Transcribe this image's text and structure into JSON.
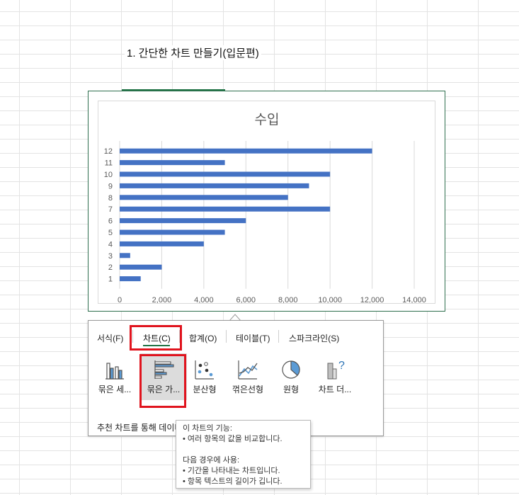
{
  "sheet": {
    "title": "1. 간단한 차트 만들기(입문편)"
  },
  "chart_data": {
    "type": "bar",
    "title": "수입",
    "categories": [
      "1",
      "2",
      "3",
      "4",
      "5",
      "6",
      "7",
      "8",
      "9",
      "10",
      "11",
      "12"
    ],
    "values": [
      1000,
      2000,
      500,
      4000,
      5000,
      6000,
      10000,
      8000,
      9000,
      10000,
      5000,
      12000
    ],
    "xlim": [
      0,
      14000
    ],
    "xticks": [
      "0",
      "2,000",
      "4,000",
      "6,000",
      "8,000",
      "10,000",
      "12,000",
      "14,000"
    ],
    "bar_color": "#4472c4",
    "grid": true
  },
  "quick_analysis": {
    "tabs": [
      {
        "label": "서식(F)",
        "active": false
      },
      {
        "label": "차트(C)",
        "active": true
      },
      {
        "label": "합계(O)",
        "active": false
      },
      {
        "label": "테이블(T)",
        "active": false
      },
      {
        "label": "스파크라인(S)",
        "active": false
      }
    ],
    "items": [
      {
        "label": "묶은 세...",
        "icon": "clustered-column-icon",
        "selected": false
      },
      {
        "label": "묶은 가...",
        "icon": "clustered-bar-icon",
        "selected": true
      },
      {
        "label": "분산형",
        "icon": "scatter-icon",
        "selected": false
      },
      {
        "label": "꺾은선형",
        "icon": "line-chart-icon",
        "selected": false
      },
      {
        "label": "원형",
        "icon": "pie-chart-icon",
        "selected": false
      },
      {
        "label": "차트 더...",
        "icon": "more-charts-icon",
        "selected": false
      }
    ],
    "hint": "추천 차트를 통해 데이터"
  },
  "tooltip": {
    "title": "이 차트의 기능:",
    "line1": "• 여러 항목의 값을 비교합니다.",
    "title2": "다음 경우에 사용:",
    "line2": "• 기간을 나타내는 차트입니다.",
    "line3": "• 항목 텍스트의 길이가 깁니다."
  },
  "colors": {
    "accent": "#217346",
    "highlight": "#e0141e"
  }
}
